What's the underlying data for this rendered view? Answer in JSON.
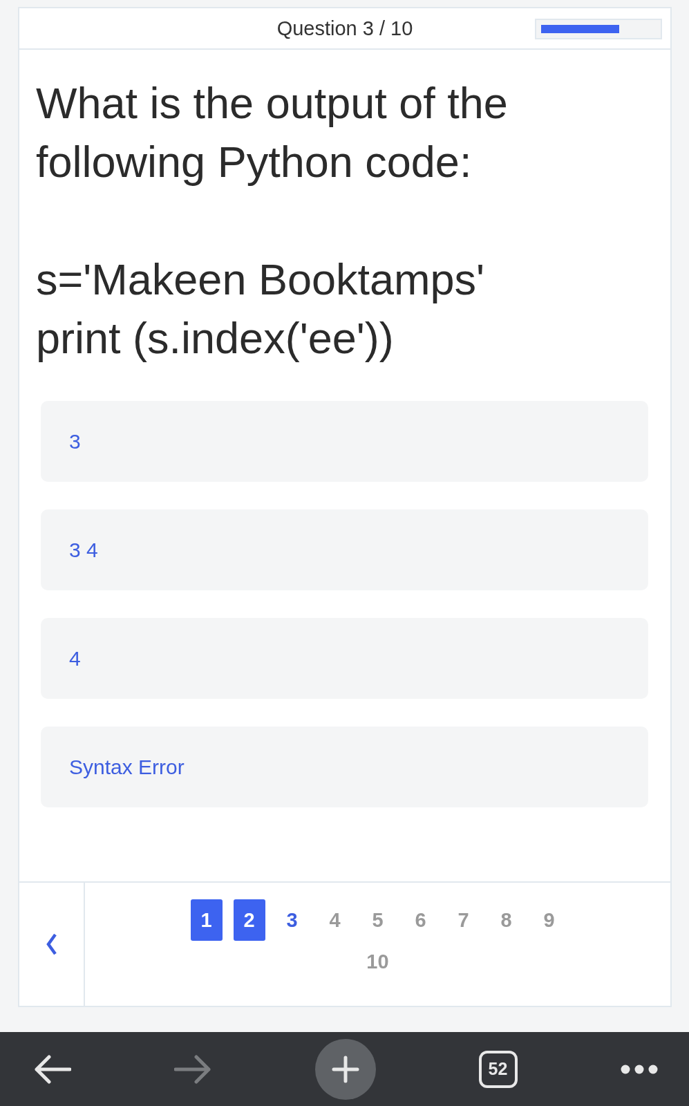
{
  "header": {
    "title": "Question 3 / 10",
    "progress": {
      "level": 0.68
    }
  },
  "question": "What is the output of the following Python code:\n\ns='Makeen Booktamps'\nprint (s.index('ee'))",
  "options": [
    {
      "label": "3"
    },
    {
      "label": "3 4"
    },
    {
      "label": "4"
    },
    {
      "label": "Syntax Error"
    }
  ],
  "pagination": {
    "pages": [
      {
        "label": "1",
        "answered": true,
        "selected": false
      },
      {
        "label": "2",
        "answered": true,
        "selected": false
      },
      {
        "label": "3",
        "answered": false,
        "selected": true
      },
      {
        "label": "4",
        "answered": false,
        "selected": false
      },
      {
        "label": "5",
        "answered": false,
        "selected": false
      },
      {
        "label": "6",
        "answered": false,
        "selected": false
      },
      {
        "label": "7",
        "answered": false,
        "selected": false
      },
      {
        "label": "8",
        "answered": false,
        "selected": false
      },
      {
        "label": "9",
        "answered": false,
        "selected": false
      },
      {
        "label": "10",
        "answered": false,
        "selected": false
      }
    ]
  },
  "browser_toolbar": {
    "forward_disabled": true,
    "tab_count": "52"
  }
}
